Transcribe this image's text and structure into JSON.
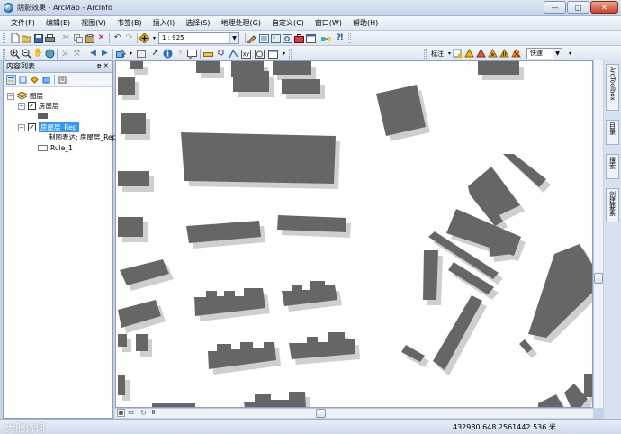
{
  "window": {
    "title": "阴影效果 - ArcMap - ArcInfo",
    "minimize_glyph": "—",
    "maximize_glyph": "□",
    "close_glyph": "✕"
  },
  "menu": [
    "文件(F)",
    "编辑(E)",
    "视图(V)",
    "书签(B)",
    "插入(I)",
    "选择(S)",
    "地理处理(G)",
    "自定义(C)",
    "窗口(W)",
    "帮助(H)"
  ],
  "standard_toolbar": {
    "scale_value": "1 : 925"
  },
  "representation_toolbar": {
    "label": "标注",
    "quick_label": "快速"
  },
  "toc": {
    "title": "内容列表",
    "pin_glyph": "ᵽ ✕",
    "layers_group": "图层",
    "layer1": "房屋层",
    "layer2": "房屋层_Rep",
    "layer2_sublabel": "制图表达: 房屋层_Rep",
    "rule": "Rule_1"
  },
  "right_dock": {
    "tabs": [
      "ArcToolbox",
      "目录",
      "搜索",
      "创建要素"
    ]
  },
  "status": {
    "coordinates": "432980.648  2561442.536 米",
    "watermark": "大败诗词"
  },
  "colors": {
    "building": "#666666",
    "shadow": "#cfcfcf",
    "selection": "#3399ff"
  }
}
